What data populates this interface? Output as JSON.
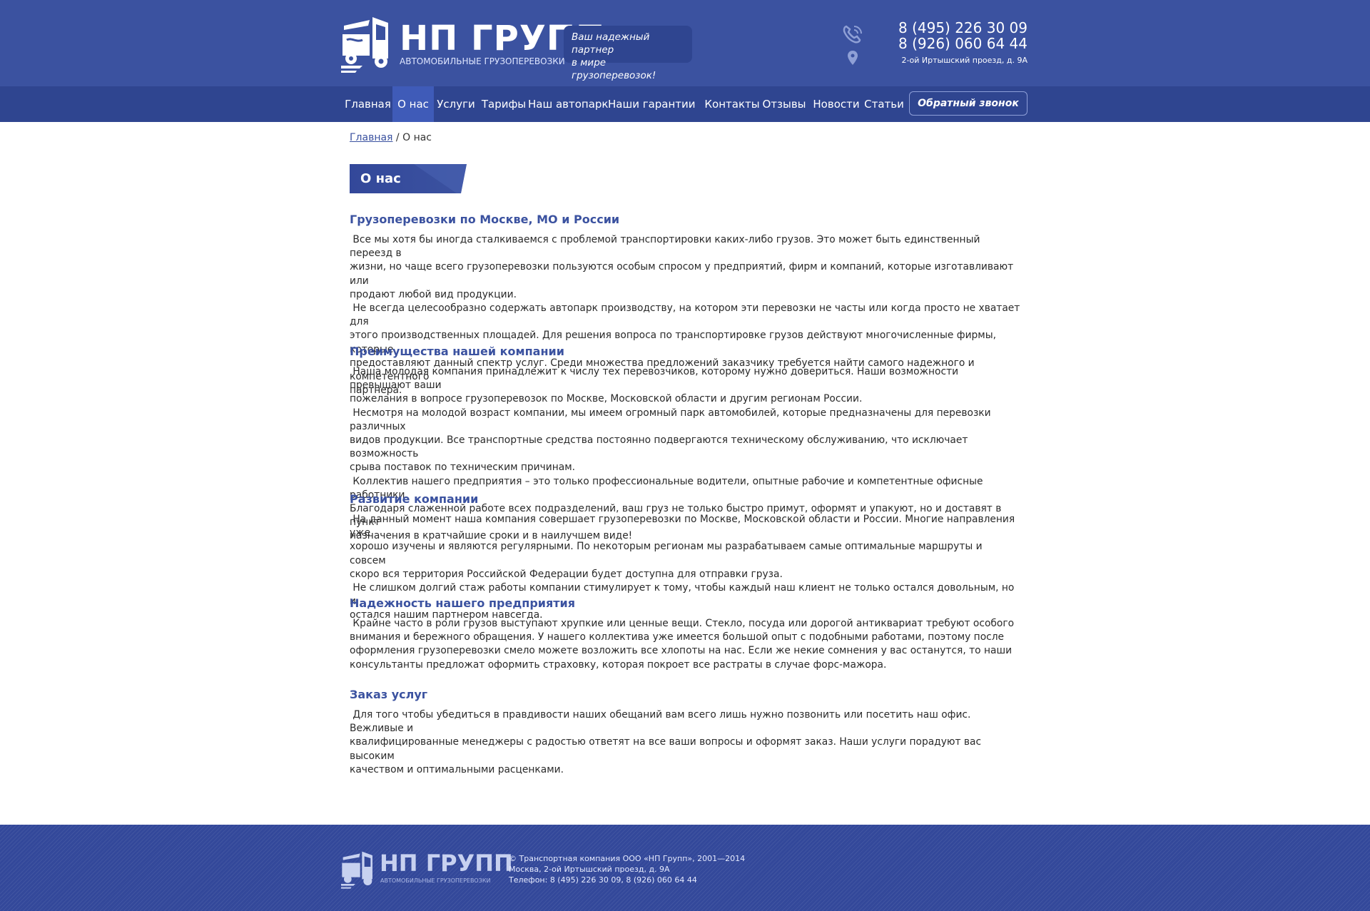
{
  "header": {
    "logo_title": "НП ГРУПП",
    "logo_subtitle": "АВТОМОБИЛЬНЫЕ ГРУЗОПЕРЕВОЗКИ",
    "slogan_line1": "Ваш надежный партнер",
    "slogan_line2": "в мире грузоперевозок!",
    "phone1": "8 (495) 226 30 09",
    "phone2": "8 (926) 060 64 44",
    "address": "2-ой Иртышский проезд, д. 9А"
  },
  "nav": {
    "items": [
      {
        "label": "Главная"
      },
      {
        "label": "О нас"
      },
      {
        "label": "Услуги"
      },
      {
        "label": "Тарифы"
      },
      {
        "label": "Наш автопарк"
      },
      {
        "label": "Наши гарантии"
      },
      {
        "label": "Контакты"
      },
      {
        "label": "Отзывы"
      },
      {
        "label": "Новости"
      },
      {
        "label": "Статьи"
      }
    ],
    "active_index": 1,
    "callback_label": "Обратный звонок"
  },
  "breadcrumb": {
    "home": "Главная",
    "separator": " / ",
    "current": "О нас"
  },
  "page_title": "О нас",
  "sections": [
    {
      "title": "Грузоперевозки по Москве, МО и России",
      "text": " Все мы хотя бы иногда сталкиваемся с проблемой транспортировки каких-либо грузов. Это может быть единственный переезд в\nжизни, но чаще всего грузоперевозки пользуются особым спросом у предприятий, фирм и компаний, которые изготавливают или\nпродают любой вид продукции.\n Не всегда целесообразно содержать автопарк производству, на котором эти перевозки не часты или когда просто не хватает для\nэтого производственных площадей. Для решения вопроса по транспортировке грузов действуют многочисленные фирмы, которые\nпредоставляют данный спектр услуг. Среди множества предложений заказчику требуется найти самого надежного и компетентного\nпартнера."
    },
    {
      "title": "Преимущества нашей компании",
      "text": " Наша молодая компания принадлежит к числу тех перевозчиков, которому нужно довериться. Наши возможности превышают ваши\nпожелания в вопросе грузоперевозок по Москве, Московской области и другим регионам России.\n Несмотря на молодой возраст компании, мы имеем огромный парк автомобилей, которые предназначены для перевозки различных\nвидов продукции. Все транспортные средства постоянно подвергаются техническому обслуживанию, что исключает возможность\nсрыва поставок по техническим причинам.\n Коллектив нашего предприятия – это только профессиональные водители, опытные рабочие и компетентные офисные работники.\nБлагодаря слаженной работе всех подразделений, ваш груз не только быстро примут, оформят и упакуют, но и доставят в пункт\nназначения в кратчайшие сроки и в наилучшем виде!"
    },
    {
      "title": "Развитие компании",
      "text": " На данный момент наша компания совершает грузоперевозки по Москве, Московской области и России. Многие направления уже\nхорошо изучены и являются регулярными. По некоторым регионам мы разрабатываем самые оптимальные маршруты и совсем\nскоро вся территория Российской Федерации будет доступна для отправки груза.\n Не слишком долгий стаж работы компании стимулирует к тому, чтобы каждый наш клиент не только остался довольным, но и\nостался нашим партнером навсегда."
    },
    {
      "title": "Надежность нашего предприятия",
      "text": " Крайне часто в роли грузов выступают хрупкие или ценные вещи. Стекло, посуда или дорогой антиквариат требуют особого\nвнимания и бережного обращения. У нашего коллектива уже имеется большой опыт с подобными работами, поэтому после\nоформления грузоперевозки смело можете возложить все хлопоты на нас. Если же некие сомнения у вас останутся, то наши\nконсультанты предложат оформить страховку, которая покроет все растраты в случае форс-мажора."
    },
    {
      "title": "Заказ услуг",
      "text": " Для того чтобы убедиться в правдивости наших обещаний вам всего лишь нужно позвонить или посетить наш офис. Вежливые и\nквалифицированные менеджеры с радостью ответят на все ваши вопросы и оформят заказ. Наши услуги порадуют вас высоким\nкачеством и оптимальными расценками."
    }
  ],
  "footer": {
    "logo_title": "НП ГРУПП",
    "logo_subtitle": "АВТОМОБИЛЬНЫЕ ГРУЗОПЕРЕВОЗКИ",
    "copyright": "© Транспортная компания ООО «НП Групп», 2001—2014",
    "address": "Москва, 2-ой Иртышский проезд, д. 9А",
    "phones": "Телефон: 8 (495) 226 30 09, 8 (926) 060 64 44"
  },
  "colors": {
    "brand_blue": "#3b52a0",
    "nav_blue": "#2f4590",
    "active_blue": "#3f5bb8"
  }
}
